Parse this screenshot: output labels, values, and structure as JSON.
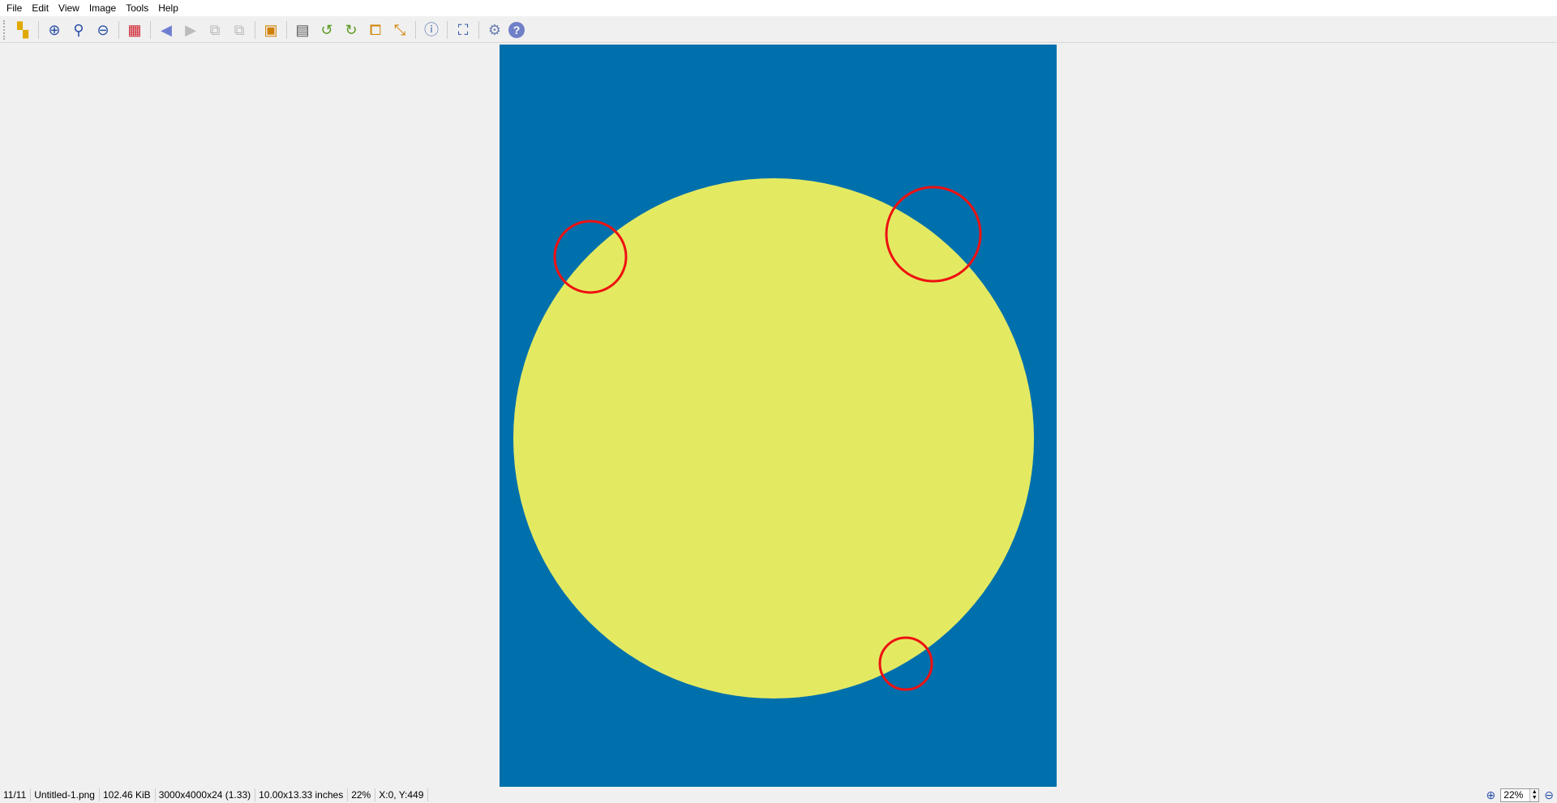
{
  "menu": [
    "File",
    "Edit",
    "View",
    "Image",
    "Tools",
    "Help"
  ],
  "toolbar": {
    "icons": [
      "thumbnails-icon",
      "zoom-in-icon",
      "zoom-original-icon",
      "zoom-out-icon",
      "grid-icon",
      "previous-icon",
      "next-icon",
      "previous-page-icon",
      "next-page-icon",
      "slideshow-icon",
      "color-adjust-icon",
      "rotate-left-icon",
      "rotate-right-icon",
      "crop-icon",
      "resize-icon",
      "info-icon",
      "fullscreen-icon",
      "settings-icon",
      "help-icon"
    ]
  },
  "image": {
    "background_color": "#0070ad",
    "circle_color": "#e3ea62",
    "marker_color": "#ee1111"
  },
  "status": {
    "index": "11/11",
    "filename": "Untitled-1.png",
    "filesize": "102.46 KiB",
    "dimensions": "3000x4000x24 (1.33)",
    "print_size": "10.00x13.33 inches",
    "zoom": "22%",
    "cursor": "X:0, Y:449"
  },
  "zoom_control": {
    "value": "22%"
  }
}
